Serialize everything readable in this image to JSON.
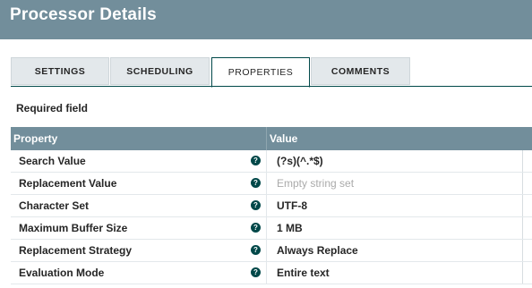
{
  "header": {
    "title": "Processor Details"
  },
  "tabs": [
    {
      "label": "SETTINGS",
      "active": false
    },
    {
      "label": "SCHEDULING",
      "active": false
    },
    {
      "label": "PROPERTIES",
      "active": true
    },
    {
      "label": "COMMENTS",
      "active": false
    }
  ],
  "required_label": "Required field",
  "table": {
    "columns": [
      "Property",
      "Value"
    ],
    "rows": [
      {
        "name": "Search Value",
        "value": "(?s)(^.*$)",
        "empty": false
      },
      {
        "name": "Replacement Value",
        "value": "Empty string set",
        "empty": true
      },
      {
        "name": "Character Set",
        "value": "UTF-8",
        "empty": false
      },
      {
        "name": "Maximum Buffer Size",
        "value": "1 MB",
        "empty": false
      },
      {
        "name": "Replacement Strategy",
        "value": "Always Replace",
        "empty": false
      },
      {
        "name": "Evaluation Mode",
        "value": "Entire text",
        "empty": false
      }
    ]
  },
  "colors": {
    "header_bg": "#728e9b",
    "accent": "#004849",
    "tab_bg": "#e3e8eb"
  },
  "icons": {
    "help": "question-circle-icon"
  }
}
